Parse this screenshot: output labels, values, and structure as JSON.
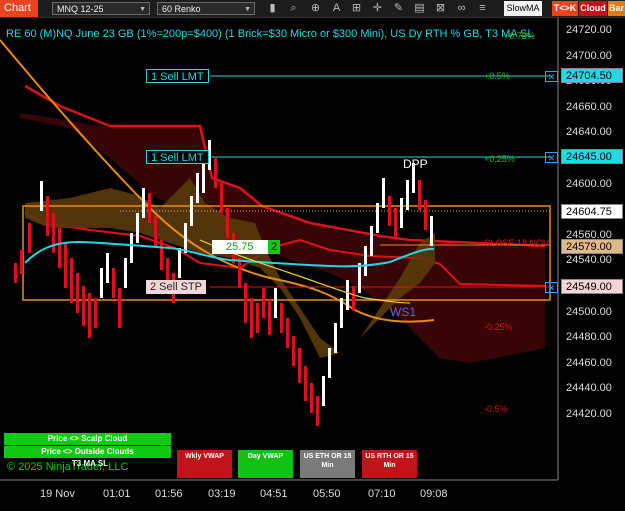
{
  "toolbar": {
    "chart_tab": "Chart",
    "instrument": "MNQ 12-25",
    "bar_type": "60 Renko",
    "slow_ma": "SlowMA",
    "tc_button": "T<>K",
    "cloud_button": "Cloud",
    "bar_button": "Bar"
  },
  "chart": {
    "title": "RE 60 (M)NQ June 23 GB (1%=200p=$400) (1 Brick=$30 Micro or $300 Mini), US Dy RTH % GB, T3 MA SL",
    "top_right_label": "+0.75%",
    "price_axis": [
      "24720.00",
      "24700.00",
      "24680.00",
      "24660.00",
      "24640.00",
      "24620.00",
      "24600.00",
      "24580.00",
      "24560.00",
      "24540.00",
      "24520.00",
      "24500.00",
      "24480.00",
      "24460.00",
      "24440.00",
      "24420.00"
    ],
    "time_axis": [
      "19 Nov",
      "01:01",
      "01:56",
      "03:19",
      "04:51",
      "05:50",
      "07:10",
      "09:08"
    ],
    "orders": [
      {
        "label": "1 Sell LMT",
        "price": "24704.50"
      },
      {
        "label": "1 Sell LMT",
        "price": "24645.00"
      },
      {
        "label": "2 Sell STP",
        "price": "24549.00"
      }
    ],
    "current_price": "24604.75",
    "close_label": "CLOSE 18 NOV",
    "close_price": "24579.00",
    "pct_labels": [
      "+0.5%",
      "+0.25%",
      "-0.25%",
      "-0.5%"
    ],
    "position_qty": "2",
    "pnl": "25.75",
    "dpp_label": "DPP",
    "ws1_label": "WS1",
    "copyright": "© 2025 NinjaTrader, LLC"
  },
  "legend": [
    "Price <> Scalp Cloud",
    "Price <> Outside Clouds",
    "T3 MA SL"
  ],
  "indicator_buttons": [
    {
      "label": "Wkly VWAP",
      "color": "#c0141a"
    },
    {
      "label": "Day VWAP",
      "color": "#13c113"
    },
    {
      "label": "US ETH OR 15 Min",
      "color": "#7a7a7a"
    },
    {
      "label": "US RTH OR 15 Min",
      "color": "#c0141a"
    }
  ],
  "colors": {
    "background": "#000000",
    "cyan": "#21d8e4",
    "orange": "#e88a12",
    "red": "#e0101a",
    "green": "#12c912"
  }
}
